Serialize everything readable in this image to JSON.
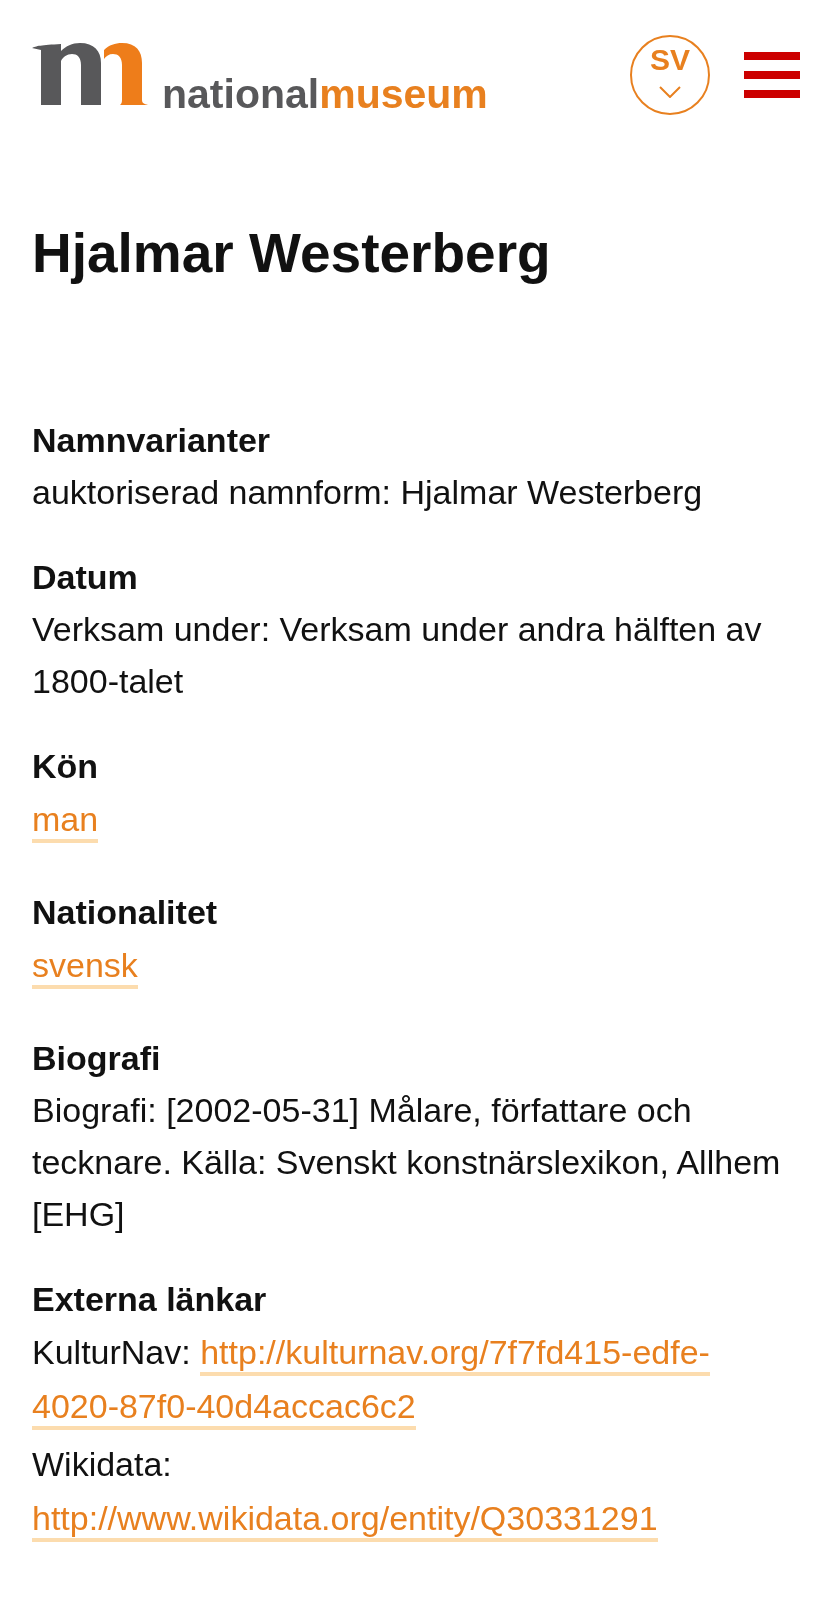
{
  "header": {
    "logo": {
      "wordmark": [
        {
          "text": "national",
          "kind": "dark"
        },
        {
          "text": "museum",
          "kind": "accent"
        }
      ]
    },
    "language": {
      "label": "SV",
      "expanded": false
    }
  },
  "title": "Hjalmar Westerberg",
  "sections": [
    {
      "heading": "Namnvarianter",
      "entries": [
        {
          "kind": "text",
          "text": "auktoriserad namnform: Hjalmar Westerberg"
        }
      ]
    },
    {
      "heading": "Datum",
      "entries": [
        {
          "kind": "text",
          "text": "Verksam under: Verksam under andra hälften av 1800-talet"
        }
      ]
    },
    {
      "heading": "Kön",
      "entries": [
        {
          "kind": "link",
          "link": "man"
        }
      ]
    },
    {
      "heading": "Nationalitet",
      "entries": [
        {
          "kind": "link",
          "link": "svensk"
        }
      ]
    },
    {
      "heading": "Biografi",
      "entries": [
        {
          "kind": "text",
          "text": "Biografi: [2002-05-31] Målare, författare och tecknare. Källa: Svenskt konstnärslexikon, Allhem [EHG]"
        }
      ]
    },
    {
      "heading": "Externa länkar",
      "entries": [
        {
          "kind": "labeled_link",
          "label": "KulturNav:",
          "link_lines": [
            "http://kulturnav.org/7f7fd415-edfe-",
            "4020-87f0-40d4accac6c2"
          ]
        },
        {
          "kind": "labeled_link",
          "label": "Wikidata:",
          "link_lines": [
            "http://www.wikidata.org/entity/Q30331291"
          ]
        }
      ]
    }
  ]
}
